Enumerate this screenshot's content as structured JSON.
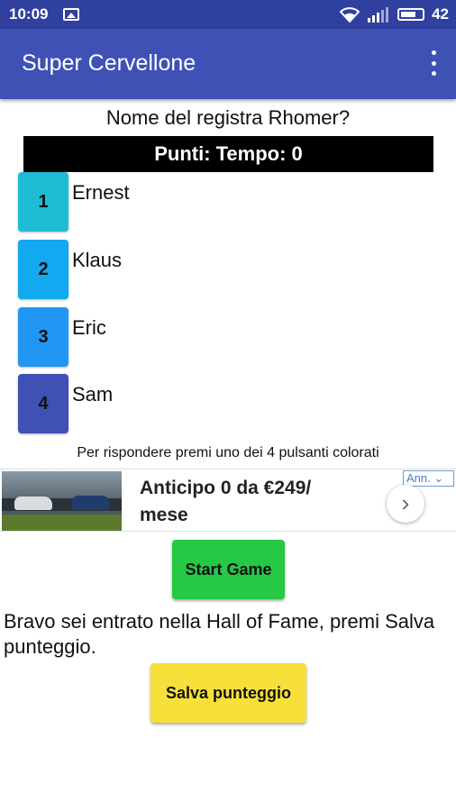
{
  "status_bar": {
    "time": "10:09",
    "battery_level": "42",
    "icons": [
      "image-icon",
      "wifi-icon",
      "signal-icon",
      "battery-icon"
    ]
  },
  "app_bar": {
    "title": "Super Cervellone",
    "menu_icon": "overflow-menu-icon"
  },
  "game": {
    "question": "Nome del registra Rhomer?",
    "score_line": "Punti:  Tempo: 0",
    "answers": [
      {
        "number": "1",
        "text": "Ernest",
        "color": "#1ebcd4"
      },
      {
        "number": "2",
        "text": "Klaus",
        "color": "#12a9f0"
      },
      {
        "number": "3",
        "text": "Eric",
        "color": "#2196f3"
      },
      {
        "number": "4",
        "text": "Sam",
        "color": "#3f51b5"
      }
    ],
    "hint": "Per rispondere premi uno dei 4 pulsanti colorati"
  },
  "ad": {
    "line1": "Anticipo 0 da €249/",
    "line2": "mese",
    "badge": "Ann.",
    "arrow": "›"
  },
  "start_button": {
    "label": "Start Game",
    "color": "#26c846"
  },
  "hall_of_fame": {
    "message": "Bravo sei entrato nella Hall of Fame, premi Salva punteggio."
  },
  "save_button": {
    "label": "Salva punteggio",
    "color": "#f7e03a"
  }
}
